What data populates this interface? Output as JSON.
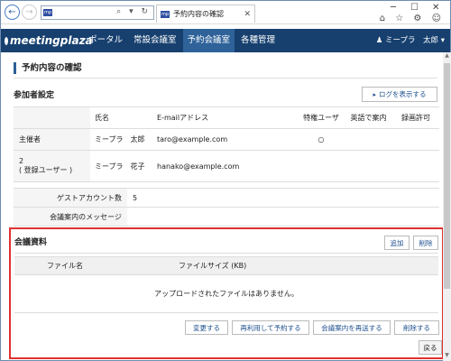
{
  "browser": {
    "address_fav": "mp",
    "address_text": "",
    "address_icons": "⌕ ▾ ↻",
    "tab_label": "予約内容の確認",
    "tab_fav": "mp",
    "back_glyph": "←",
    "forward_glyph": "→",
    "min_glyph": "─",
    "max_glyph": "☐",
    "close_glyph": "✕",
    "tool_icons": "⌂ ☆ ⚙ ☺"
  },
  "navbar": {
    "logo": "meetingplaza",
    "items": [
      "ポータル",
      "常設会議室",
      "予約会議室",
      "各種管理"
    ],
    "active_index": 2,
    "user": "♟ ミープラ　太郎 ▾"
  },
  "page": {
    "title": "予約内容の確認"
  },
  "participants": {
    "section_title": "参加者設定",
    "log_button": "ログを表示する",
    "log_button_icon": "▸",
    "headers": [
      "",
      "氏名",
      "E-mailアドレス",
      "特権ユーザ",
      "英語で案内",
      "録画許可"
    ],
    "rows": [
      {
        "role": "主催者",
        "role_sub": "",
        "name": "ミープラ　太郎",
        "email": "taro@example.com",
        "privileged": "○",
        "english": "",
        "recording": ""
      },
      {
        "role": "2",
        "role_sub": "( 登録ユーザー )",
        "name": "ミープラ　花子",
        "email": "hanako@example.com",
        "privileged": "",
        "english": "",
        "recording": ""
      }
    ]
  },
  "guest": {
    "rows": [
      {
        "label": "ゲストアカウント数",
        "value": "5"
      },
      {
        "label": "会議案内のメッセージ",
        "value": ""
      }
    ]
  },
  "materials": {
    "title": "会議資料",
    "add_button": "追加",
    "delete_button": "削除",
    "headers": [
      "",
      "ファイル名",
      "ファイルサイズ (KB)"
    ],
    "empty_message": "アップロードされたファイルはありません。",
    "actions": [
      "変更する",
      "再利用して予約する",
      "会議案内を再送する",
      "削除する"
    ],
    "back_button": "戻る"
  },
  "colors": {
    "navbar": "#17406f",
    "nav_active": "#2e6299",
    "highlight": "#e03030",
    "link": "#1e4f8c"
  }
}
